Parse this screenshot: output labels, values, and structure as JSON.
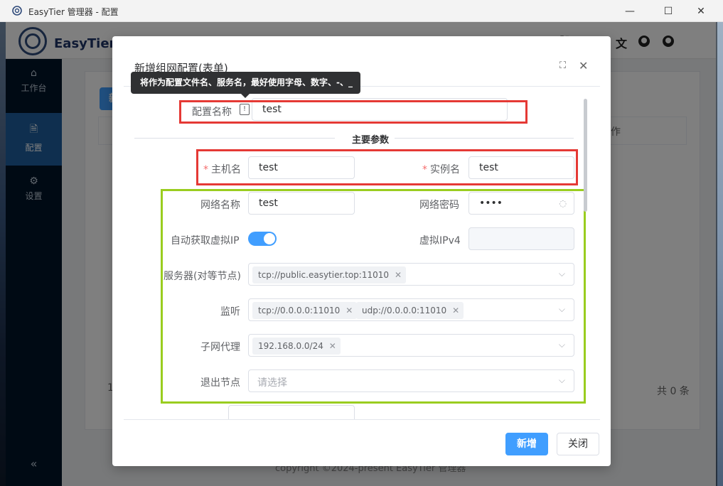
{
  "window": {
    "title": "EasyTier 管理器 - 配置",
    "min_glyph": "—",
    "max_glyph": "☐",
    "close_glyph": "✕"
  },
  "header": {
    "brand": "EasyTier 管",
    "icons": [
      "translate-icon",
      "github-icon",
      "github-icon"
    ]
  },
  "sidebar": {
    "items": [
      {
        "label": "工作台",
        "icon": "home-icon"
      },
      {
        "label": "配置",
        "icon": "file-add-icon",
        "active": true
      },
      {
        "label": "设置",
        "icon": "gear-icon"
      }
    ],
    "collapse_glyph": "«"
  },
  "background": {
    "table_header": "作",
    "footer_count": "共 0 条",
    "pager_first": "1",
    "copyright": "copyright ©2024-present EasyTier 管理器",
    "new_btn": "新"
  },
  "dialog": {
    "title": "新增组网配置(表单)",
    "tooltip": "将作为配置文件名、服务名，最好使用字母、数字、-、_",
    "config_name": {
      "label": "配置名称",
      "value": "test"
    },
    "section_title": "主要参数",
    "hostname": {
      "label": "主机名",
      "value": "test"
    },
    "instance_name": {
      "label": "实例名",
      "value": "test"
    },
    "network_name": {
      "label": "网络名称",
      "value": "test"
    },
    "network_secret": {
      "label": "网络密码",
      "value": "••••"
    },
    "dhcp": {
      "label": "自动获取虚拟IP",
      "on": true
    },
    "virtual_ipv4": {
      "label": "虚拟IPv4",
      "value": ""
    },
    "peers": {
      "label": "服务器(对等节点)",
      "tags": [
        "tcp://public.easytier.top:11010"
      ]
    },
    "listeners": {
      "label": "监听",
      "tags": [
        "tcp://0.0.0.0:11010",
        "udp://0.0.0.0:11010"
      ]
    },
    "proxy_cidrs": {
      "label": "子网代理",
      "tags": [
        "192.168.0.0/24"
      ]
    },
    "exit_nodes": {
      "label": "退出节点",
      "placeholder": "请选择"
    },
    "buttons": {
      "confirm": "新增",
      "close": "关闭"
    }
  },
  "colors": {
    "highlight_red": "#e53935",
    "highlight_green": "#9acd1f",
    "primary": "#409eff",
    "sidebar": "#001529"
  }
}
